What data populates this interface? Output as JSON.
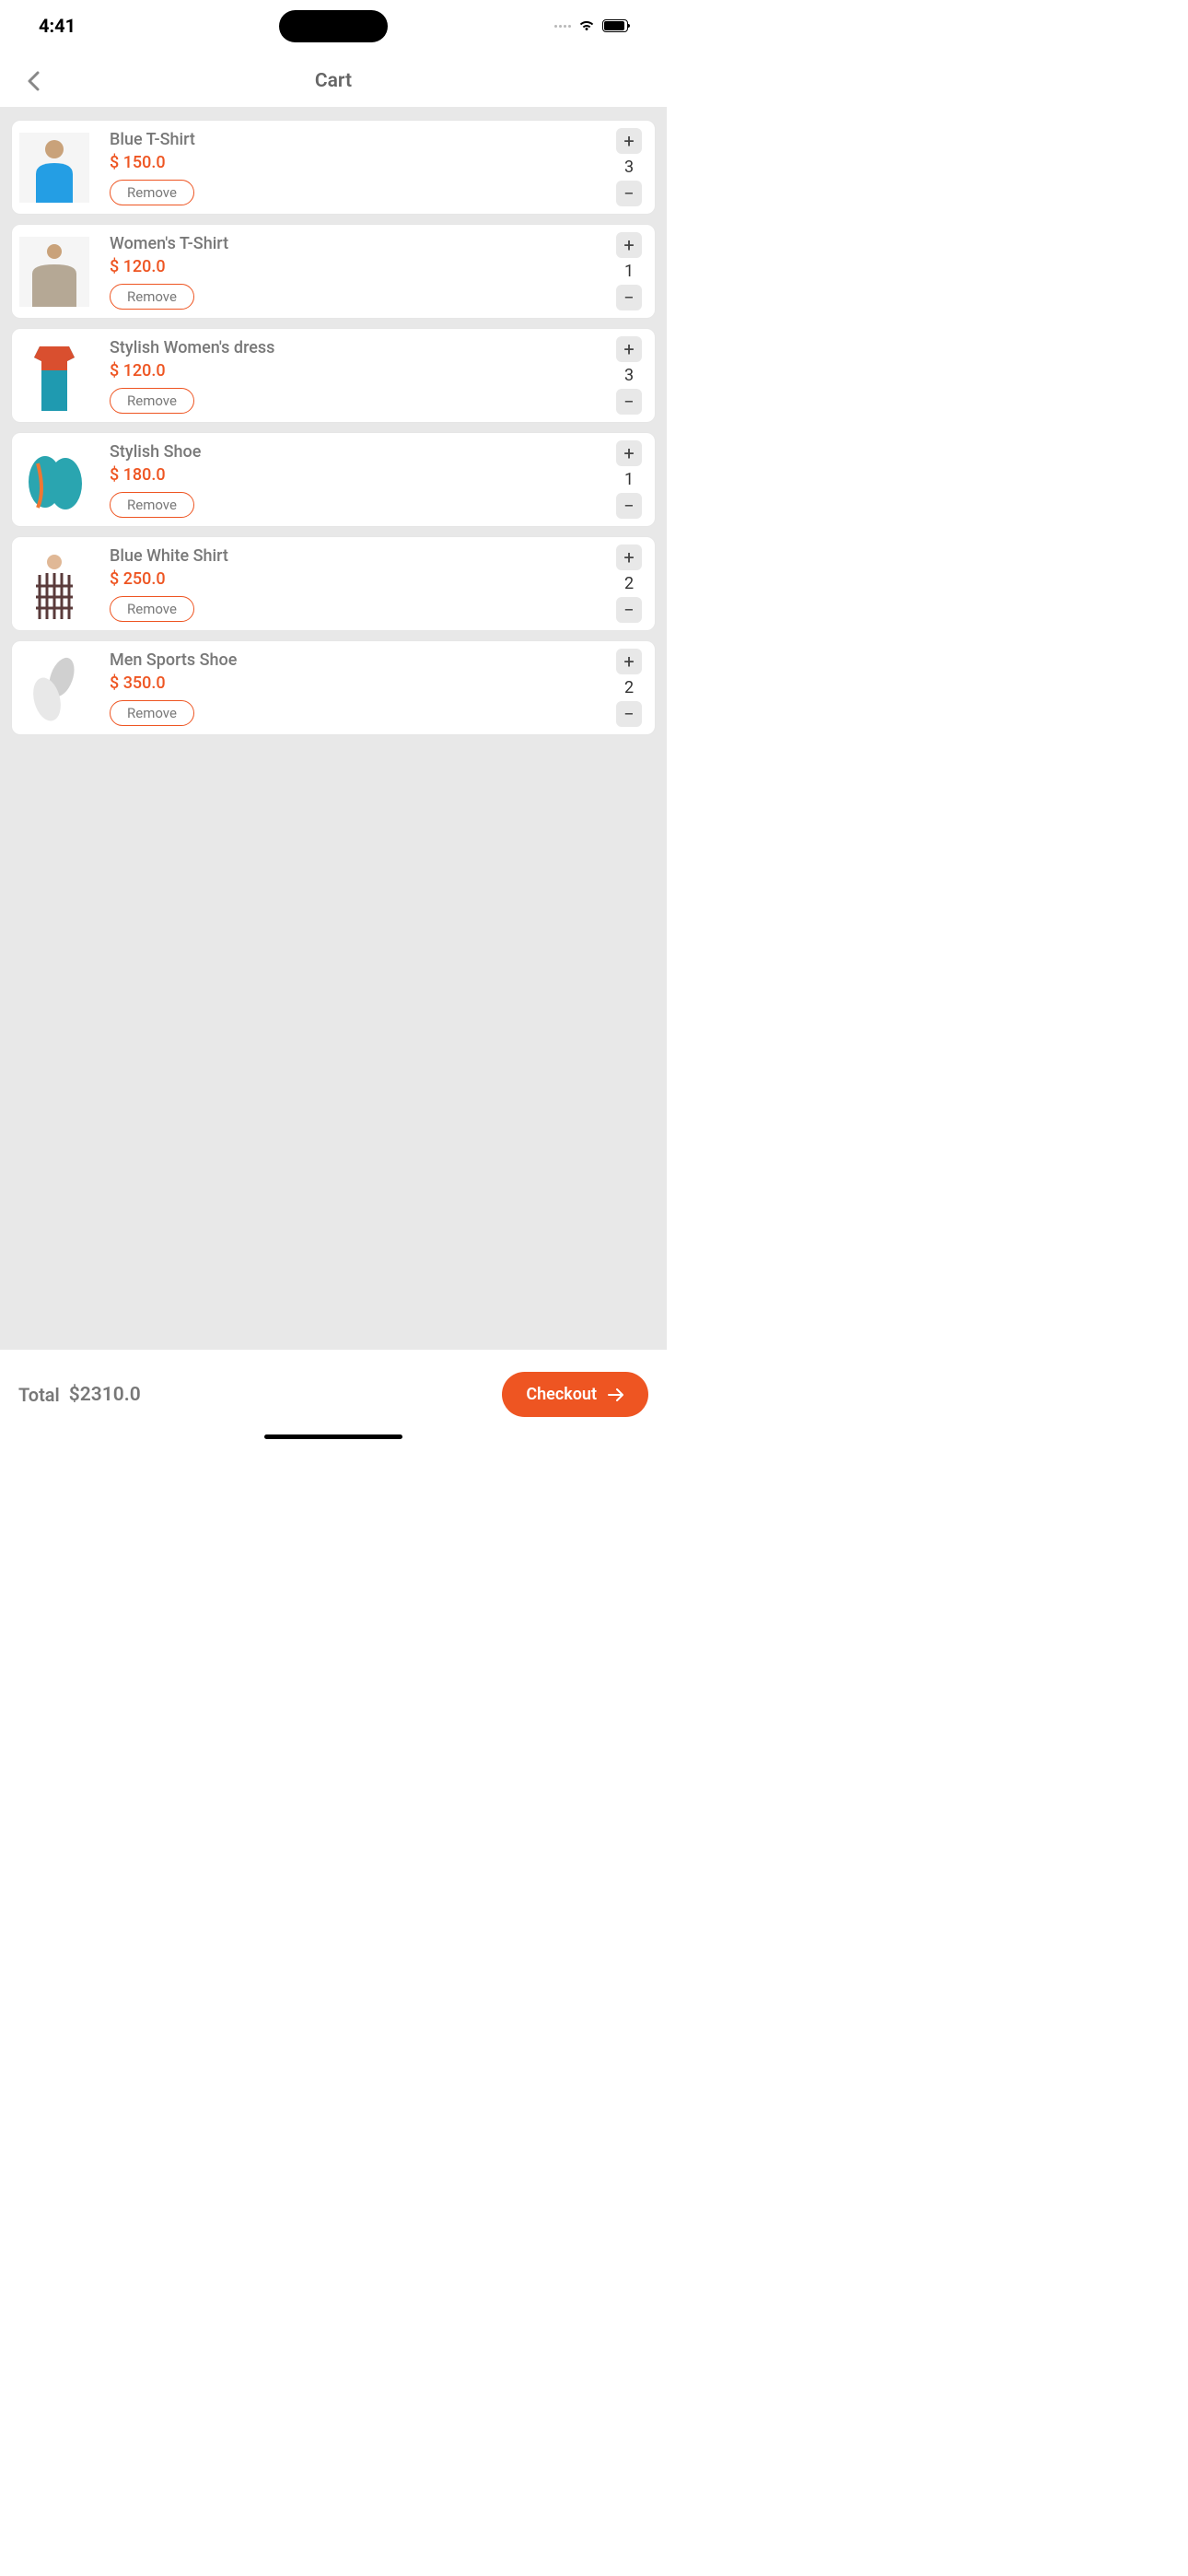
{
  "status": {
    "time": "4:41"
  },
  "header": {
    "title": "Cart"
  },
  "labels": {
    "remove": "Remove",
    "total": "Total",
    "checkout": "Checkout"
  },
  "cart": {
    "items": [
      {
        "name": "Blue T-Shirt",
        "price": "$ 150.0",
        "qty": "3"
      },
      {
        "name": "Women's T-Shirt",
        "price": "$ 120.0",
        "qty": "1"
      },
      {
        "name": "Stylish Women's dress",
        "price": "$ 120.0",
        "qty": "3"
      },
      {
        "name": "Stylish Shoe",
        "price": "$ 180.0",
        "qty": "1"
      },
      {
        "name": "Blue White Shirt",
        "price": "$ 250.0",
        "qty": "2"
      },
      {
        "name": "Men Sports Shoe",
        "price": "$ 350.0",
        "qty": "2"
      }
    ],
    "total": "$2310.0"
  }
}
